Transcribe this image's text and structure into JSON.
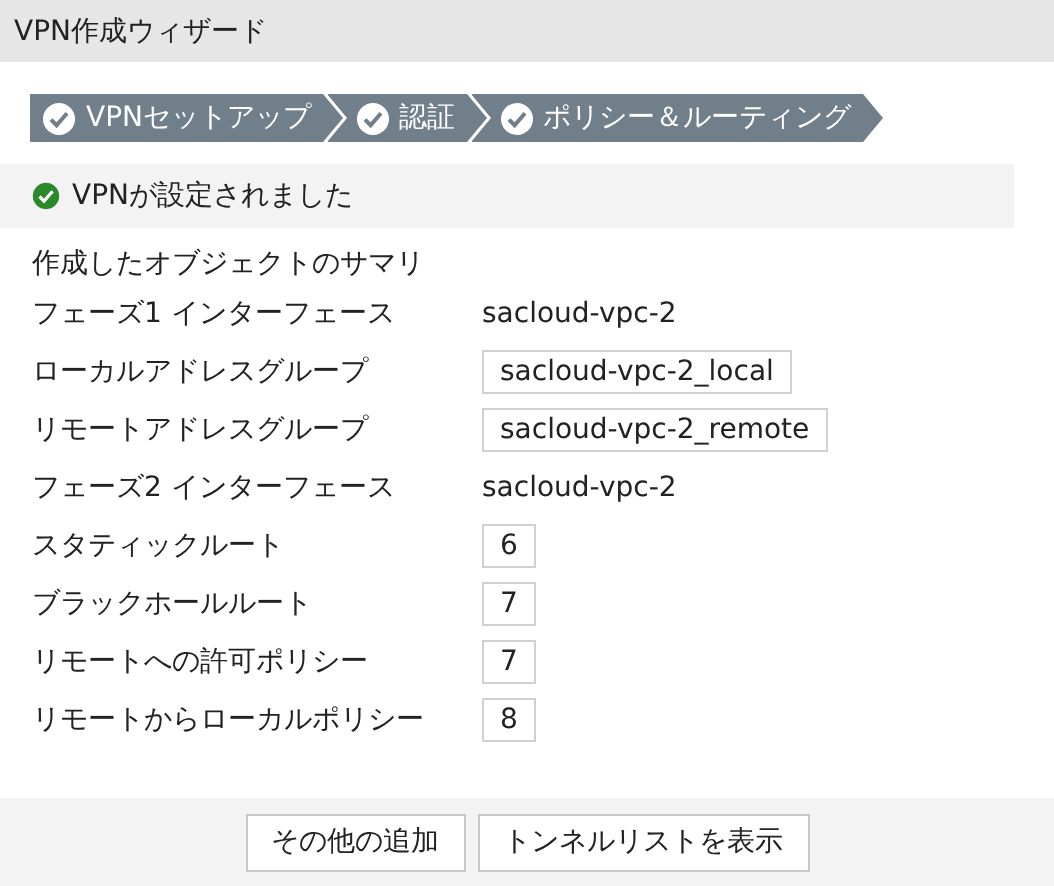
{
  "window": {
    "title": "VPN作成ウィザード"
  },
  "steps": [
    {
      "label": "VPNセットアップ"
    },
    {
      "label": "認証"
    },
    {
      "label": "ポリシー＆ルーティング"
    }
  ],
  "banner": {
    "message": "VPNが設定されました"
  },
  "summary": {
    "heading": "作成したオブジェクトのサマリ",
    "rows": [
      {
        "label": "フェーズ1 インターフェース",
        "value": "sacloud-vpc-2",
        "kind": "text"
      },
      {
        "label": "ローカルアドレスグループ",
        "value": "sacloud-vpc-2_local",
        "kind": "box"
      },
      {
        "label": "リモートアドレスグループ",
        "value": "sacloud-vpc-2_remote",
        "kind": "box"
      },
      {
        "label": "フェーズ2 インターフェース",
        "value": "sacloud-vpc-2",
        "kind": "text"
      },
      {
        "label": "スタティックルート",
        "value": "6",
        "kind": "box"
      },
      {
        "label": "ブラックホールルート",
        "value": "7",
        "kind": "box"
      },
      {
        "label": "リモートへの許可ポリシー",
        "value": "7",
        "kind": "box"
      },
      {
        "label": "リモートからローカルポリシー",
        "value": "8",
        "kind": "box"
      }
    ]
  },
  "buttons": [
    "その他の追加",
    "トンネルリストを表示"
  ]
}
